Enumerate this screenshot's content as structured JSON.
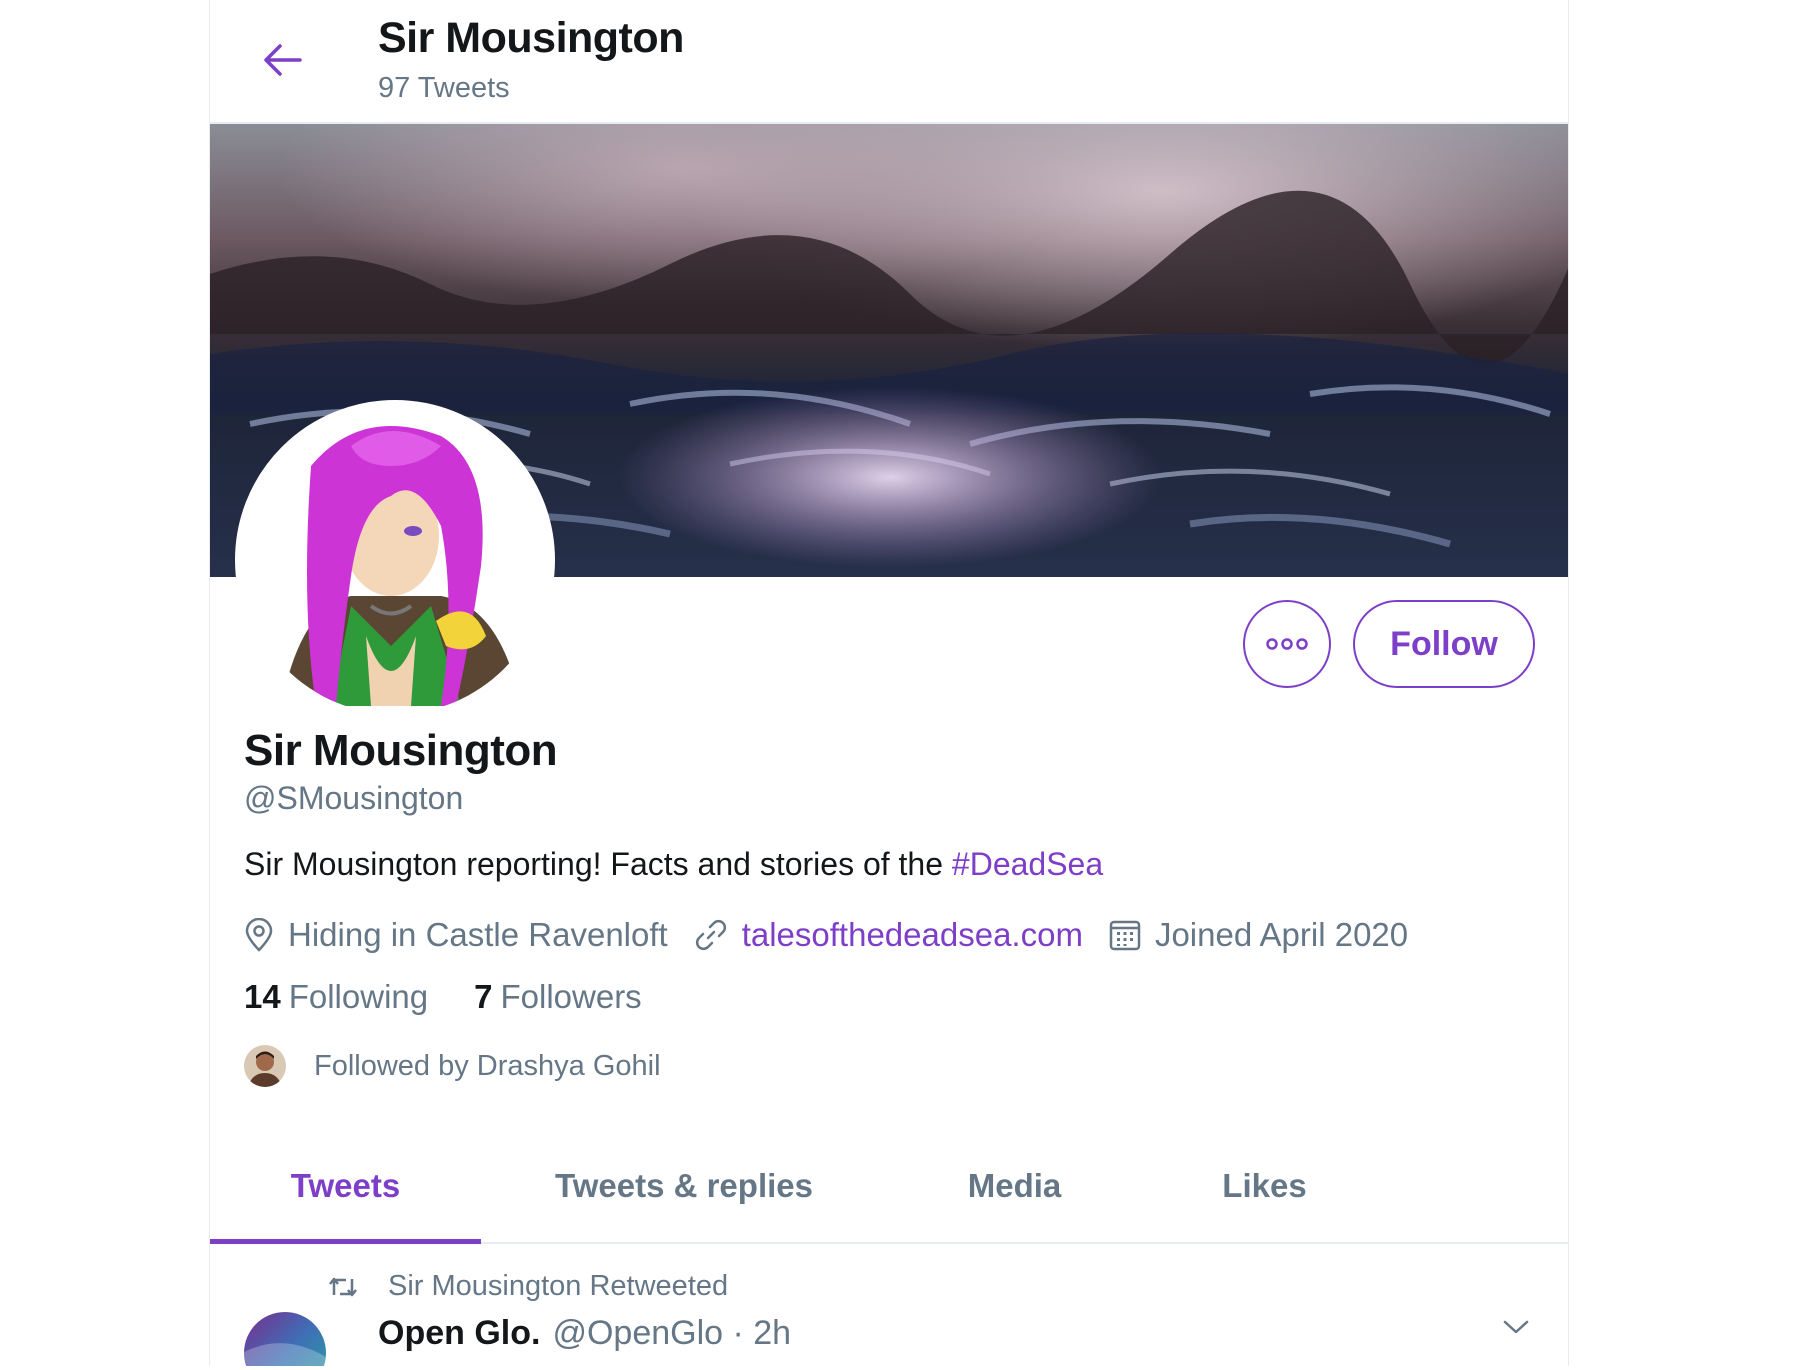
{
  "header": {
    "title": "Sir Mousington",
    "tweet_count": "97 Tweets"
  },
  "profile": {
    "display_name": "Sir Mousington",
    "handle": "@SMousington",
    "bio_text": "Sir Mousington reporting! Facts and stories of the ",
    "bio_hashtag": "#DeadSea",
    "location": "Hiding in Castle Ravenloft",
    "website": "talesofthedeadsea.com",
    "joined": "Joined April 2020",
    "following_count": "14",
    "following_label": "Following",
    "followers_count": "7",
    "followers_label": "Followers",
    "followed_by": "Followed by Drashya Gohil",
    "follow_label": "Follow"
  },
  "tabs": [
    {
      "label": "Tweets",
      "active": true
    },
    {
      "label": "Tweets & replies",
      "active": false
    },
    {
      "label": "Media",
      "active": false
    },
    {
      "label": "Likes",
      "active": false
    }
  ],
  "tweet": {
    "retweet_text": "Sir Mousington Retweeted",
    "author_name": "Open Glo.",
    "author_meta": "@OpenGlo · 2h"
  },
  "icons": {
    "back": "arrow-left-icon",
    "more": "more-dots-icon",
    "location": "location-pin-icon",
    "link": "link-icon",
    "calendar": "calendar-icon",
    "retweet": "retweet-icon",
    "caret": "chevron-down-icon"
  },
  "colors": {
    "accent": "#7d3fc8",
    "secondary_text": "#657786",
    "primary_text": "#14171a",
    "border": "#e6ecf0"
  }
}
